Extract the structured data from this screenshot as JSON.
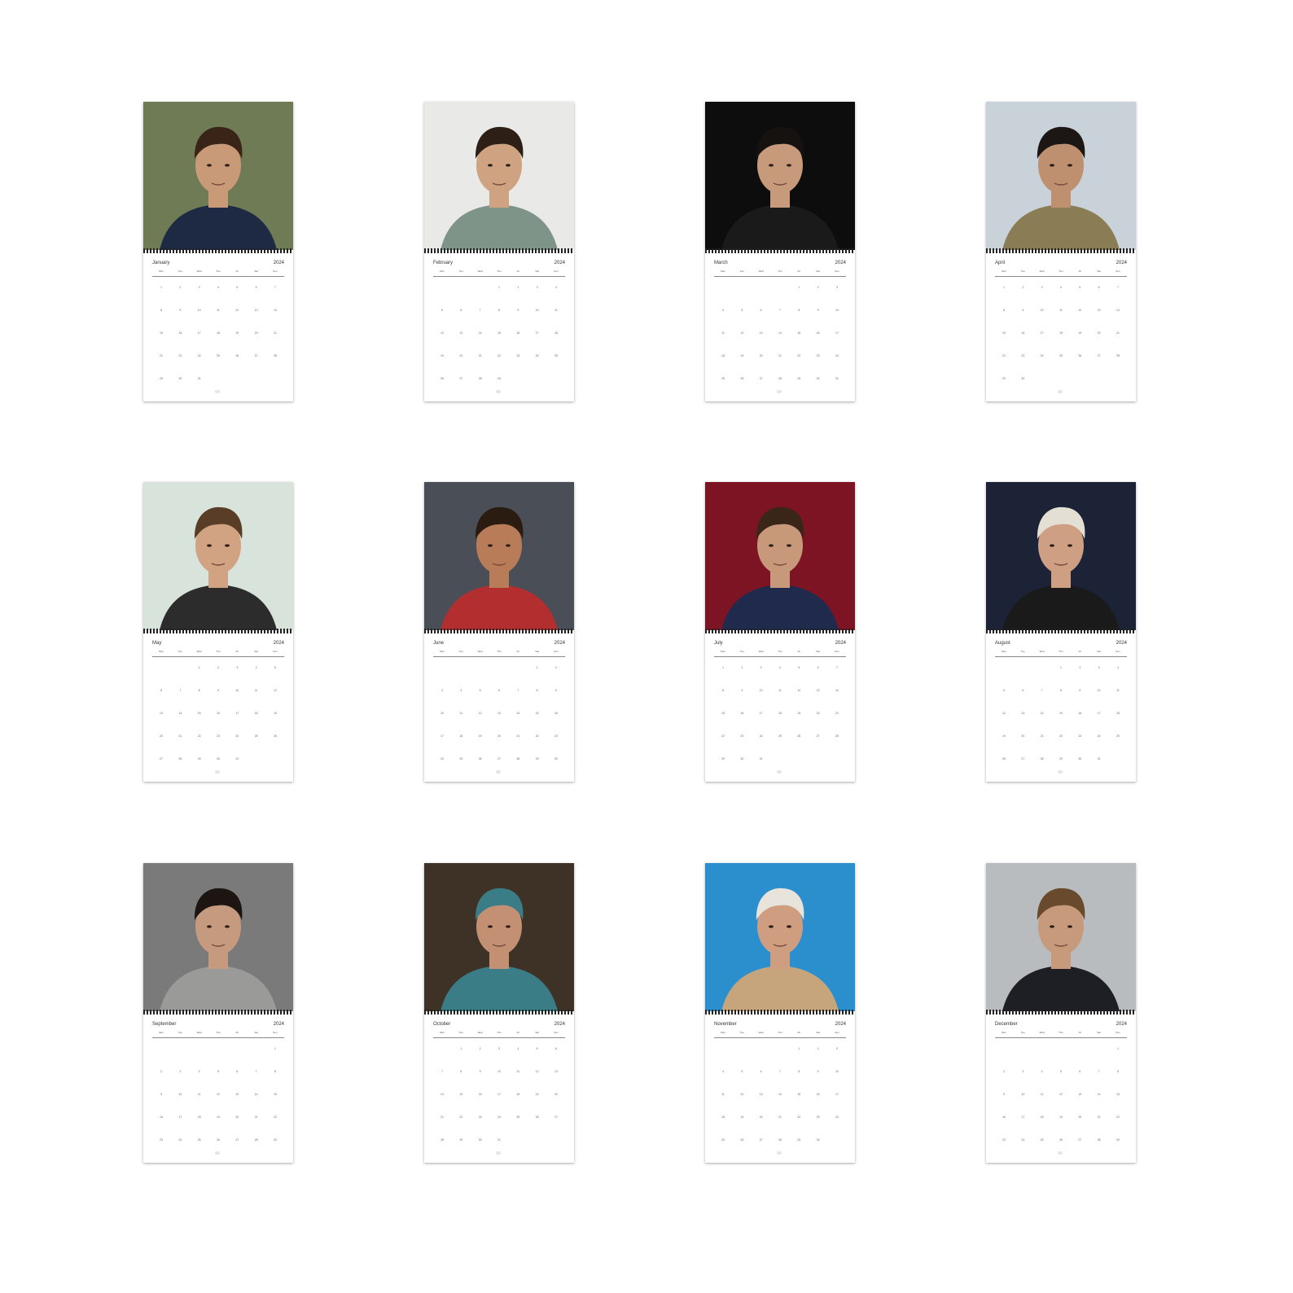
{
  "year": "2024",
  "weekdays": [
    "Mon",
    "Tue",
    "Wed",
    "Thu",
    "Fri",
    "Sat",
    "Sun"
  ],
  "months": [
    {
      "name": "January",
      "photo": "man-with-bow-photo",
      "bg": "#6f7b55",
      "accent": "#1e2a44",
      "skin": "#c99a78",
      "hair": "#3a2418"
    },
    {
      "name": "February",
      "photo": "man-grey-tee-photo",
      "bg": "#e9e9e7",
      "accent": "#7f9488",
      "skin": "#cfa382",
      "hair": "#2e1f16"
    },
    {
      "name": "March",
      "photo": "man-leather-jacket-photo",
      "bg": "#0d0d0d",
      "accent": "#1a1a1a",
      "skin": "#c79a7c",
      "hair": "#161210"
    },
    {
      "name": "April",
      "photo": "man-olive-jacket-photo",
      "bg": "#c9d2d8",
      "accent": "#8a7c54",
      "skin": "#bf9070",
      "hair": "#1c1614"
    },
    {
      "name": "May",
      "photo": "man-popped-collar-photo",
      "bg": "#d8e3dc",
      "accent": "#2c2c2c",
      "skin": "#d1a383",
      "hair": "#5a3d26"
    },
    {
      "name": "June",
      "photo": "man-shirtless-photo",
      "bg": "#4a4f57",
      "accent": "#b32e2e",
      "skin": "#b87d58",
      "hair": "#2b1c12"
    },
    {
      "name": "July",
      "photo": "man-suit-photo",
      "bg": "#7d1424",
      "accent": "#1f2a4d",
      "skin": "#c7987a",
      "hair": "#3a2618"
    },
    {
      "name": "August",
      "photo": "man-blond-smile-photo",
      "bg": "#1d2336",
      "accent": "#1a1a1a",
      "skin": "#cf9f84",
      "hair": "#e4dfd4"
    },
    {
      "name": "September",
      "photo": "man-portrait-photo",
      "bg": "#7a7a7a",
      "accent": "#9a9a98",
      "skin": "#c69a7e",
      "hair": "#1d1511"
    },
    {
      "name": "October",
      "photo": "man-beanie-photo",
      "bg": "#3e3226",
      "accent": "#3b7d86",
      "skin": "#c49074",
      "hair": "#3b7d86"
    },
    {
      "name": "November",
      "photo": "man-shearling-photo",
      "bg": "#2b8fce",
      "accent": "#c7a57c",
      "skin": "#cf9d80",
      "hair": "#e8e4dc"
    },
    {
      "name": "December",
      "photo": "man-dark-coat-photo",
      "bg": "#b9bcbf",
      "accent": "#1d1f24",
      "skin": "#c89a7c",
      "hair": "#6a4a2c"
    }
  ],
  "footer_mark": "",
  "colors": {
    "background": "#ffffff",
    "binding": "#222222",
    "text": "#333333"
  }
}
